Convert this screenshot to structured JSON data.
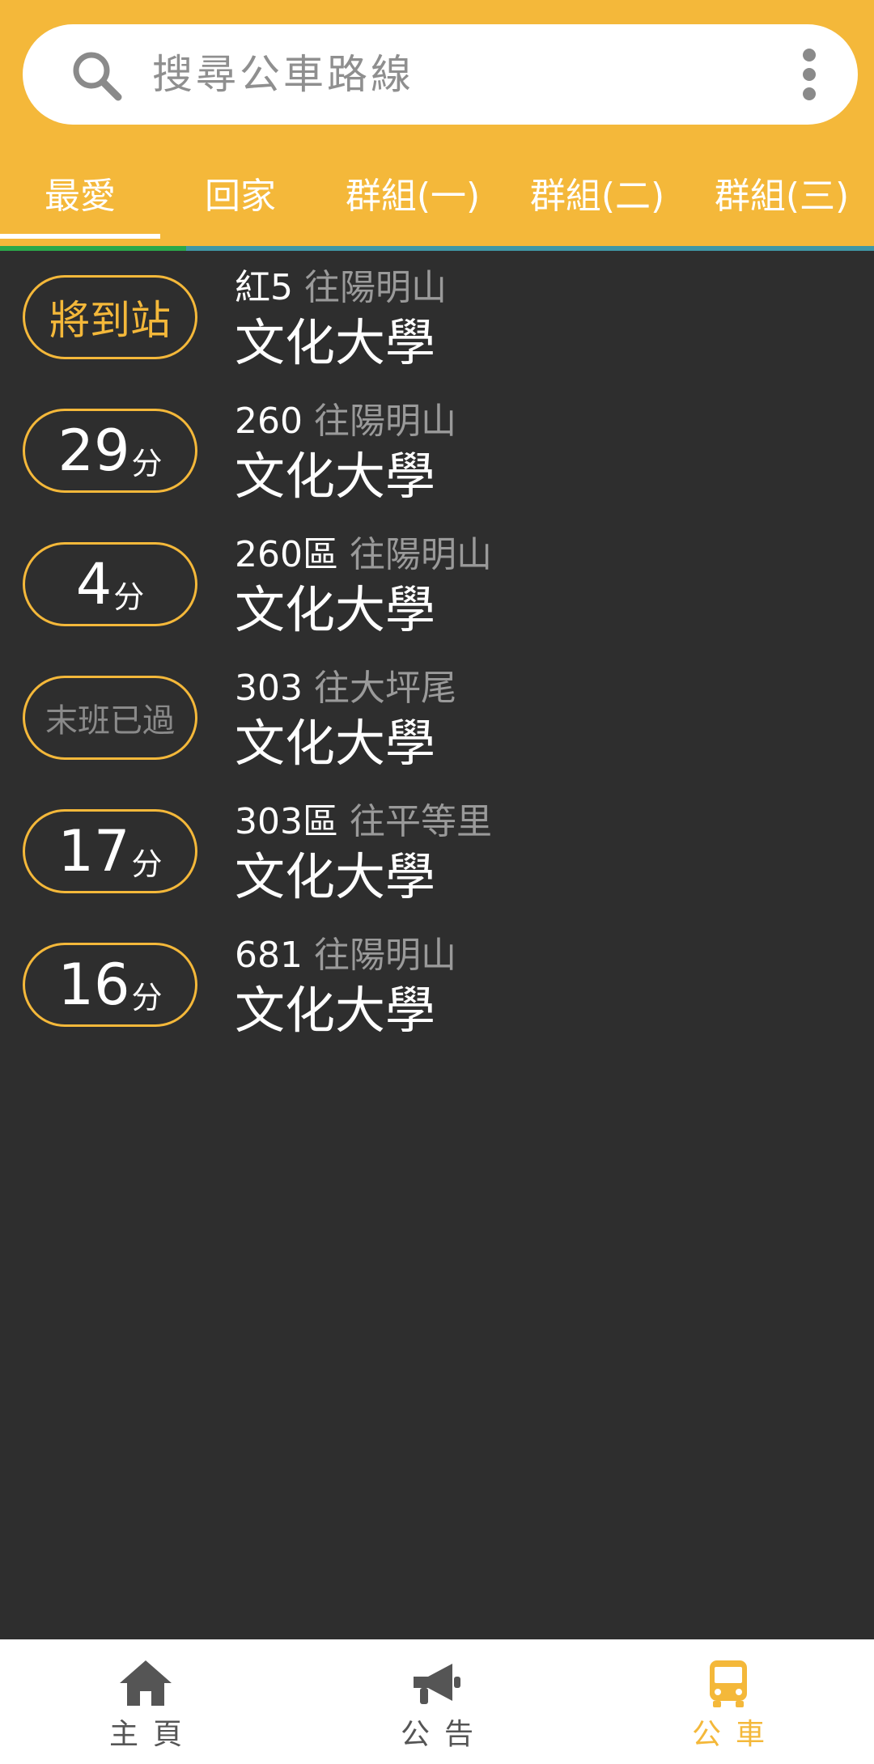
{
  "search": {
    "placeholder": "搜尋公車路線"
  },
  "tabs": [
    {
      "label": "最愛"
    },
    {
      "label": "回家"
    },
    {
      "label": "群組(一)"
    },
    {
      "label": "群組(二)"
    },
    {
      "label": "群組(三)"
    }
  ],
  "active_tab": "最愛",
  "routes": [
    {
      "status_text": "將到站",
      "route": "紅5",
      "direction": "往陽明山",
      "stop": "文化大學"
    },
    {
      "eta_value": "29",
      "eta_unit": "分",
      "route": "260",
      "direction": "往陽明山",
      "stop": "文化大學"
    },
    {
      "eta_value": "4",
      "eta_unit": "分",
      "route": "260區",
      "direction": "往陽明山",
      "stop": "文化大學"
    },
    {
      "status_text": "末班已過",
      "route": "303",
      "direction": "往大坪尾",
      "stop": "文化大學"
    },
    {
      "eta_value": "17",
      "eta_unit": "分",
      "route": "303區",
      "direction": "往平等里",
      "stop": "文化大學"
    },
    {
      "eta_value": "16",
      "eta_unit": "分",
      "route": "681",
      "direction": "往陽明山",
      "stop": "文化大學"
    }
  ],
  "bottom_nav": [
    {
      "label": "主頁",
      "icon": "home-icon"
    },
    {
      "label": "公告",
      "icon": "megaphone-icon"
    },
    {
      "label": "公車",
      "icon": "bus-icon"
    }
  ],
  "active_nav": "公車",
  "colors": {
    "accent": "#f4b83a",
    "background": "#2e2e2e",
    "muted_text": "#9a9a9a"
  }
}
